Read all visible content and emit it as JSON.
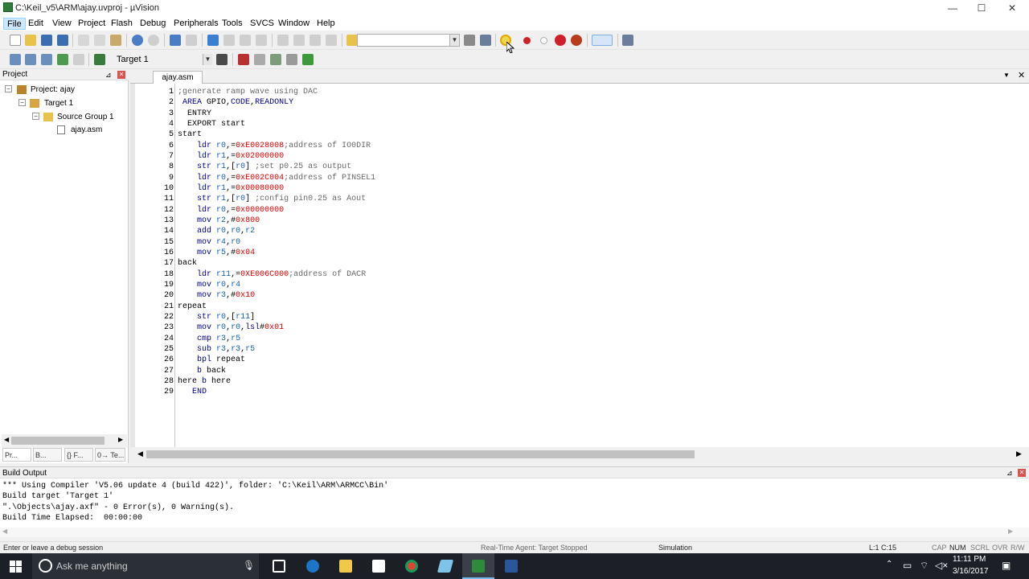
{
  "window": {
    "title": "C:\\Keil_v5\\ARM\\ajay.uvproj - µVision",
    "min": "—",
    "max": "☐",
    "close": "✕"
  },
  "menu": [
    "File",
    "Edit",
    "View",
    "Project",
    "Flash",
    "Debug",
    "Peripherals",
    "Tools",
    "SVCS",
    "Window",
    "Help"
  ],
  "toolbar2": {
    "target": "Target 1"
  },
  "project_panel": {
    "title": "Project",
    "tree": {
      "project": "Project: ajay",
      "target": "Target 1",
      "group": "Source Group 1",
      "file": "ajay.asm"
    },
    "tabs": [
      "Pr...",
      "B...",
      "{} F...",
      "0→ Te..."
    ]
  },
  "editor": {
    "tab": "ajay.asm",
    "lines": [
      "1",
      "2",
      "3",
      "4",
      "5",
      "6",
      "7",
      "8",
      "9",
      "10",
      "11",
      "12",
      "13",
      "14",
      "15",
      "16",
      "17",
      "18",
      "19",
      "20",
      "21",
      "22",
      "23",
      "24",
      "25",
      "26",
      "27",
      "28",
      "29"
    ]
  },
  "build": {
    "title": "Build Output",
    "lines": [
      "*** Using Compiler 'V5.06 update 4 (build 422)', folder: 'C:\\Keil\\ARM\\ARMCC\\Bin'",
      "Build target 'Target 1'",
      "\".\\Objects\\ajay.axf\" - 0 Error(s), 0 Warning(s).",
      "Build Time Elapsed:  00:00:00"
    ]
  },
  "status": {
    "hint": "Enter or leave a debug session",
    "agent": "Real-Time Agent: Target Stopped",
    "mode": "Simulation",
    "pos": "L:1 C:15",
    "cap": "CAP",
    "num": "NUM",
    "scrl": "SCRL",
    "ovr": "OVR",
    "rw": "R/W"
  },
  "taskbar": {
    "search": "Ask me anything",
    "time": "11:11 PM",
    "date": "3/16/2017"
  },
  "colors": {
    "keyword": "#00008b",
    "register": "#1a5fb4",
    "number": "#e00000",
    "comment": "#6a6a6a"
  }
}
